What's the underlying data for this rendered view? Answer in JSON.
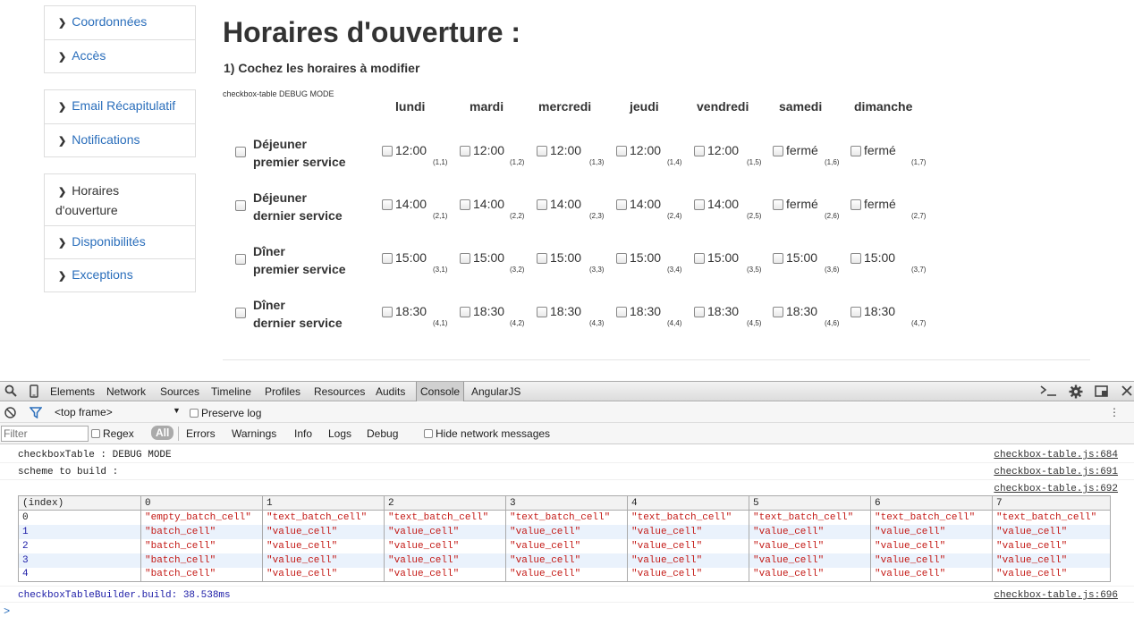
{
  "sidebar": {
    "group1": [
      "Coordonnées",
      "Accès"
    ],
    "group2": [
      "Email Récapitulatif",
      "Notifications"
    ],
    "group3_active": "Horaires d'ouverture",
    "group3": [
      "Disponibilités",
      "Exceptions"
    ]
  },
  "main": {
    "title": "Horaires d'ouverture :",
    "step": "1) Cochez les horaires à modifier",
    "debug": "checkbox-table DEBUG MODE",
    "days": [
      "lundi",
      "mardi",
      "mercredi",
      "jeudi",
      "vendredi",
      "samedi",
      "dimanche"
    ],
    "rows": [
      {
        "label1": "Déjeuner",
        "label2": "premier service",
        "values": [
          "12:00",
          "12:00",
          "12:00",
          "12:00",
          "12:00",
          "fermé",
          "fermé"
        ],
        "idx": [
          "(1,1)",
          "(1,2)",
          "(1,3)",
          "(1,4)",
          "(1,5)",
          "(1,6)",
          "(1,7)"
        ]
      },
      {
        "label1": "Déjeuner",
        "label2": "dernier service",
        "values": [
          "14:00",
          "14:00",
          "14:00",
          "14:00",
          "14:00",
          "fermé",
          "fermé"
        ],
        "idx": [
          "(2,1)",
          "(2,2)",
          "(2,3)",
          "(2,4)",
          "(2,5)",
          "(2,6)",
          "(2,7)"
        ]
      },
      {
        "label1": "Dîner",
        "label2": "premier service",
        "values": [
          "15:00",
          "15:00",
          "15:00",
          "15:00",
          "15:00",
          "15:00",
          "15:00"
        ],
        "idx": [
          "(3,1)",
          "(3,2)",
          "(3,3)",
          "(3,4)",
          "(3,5)",
          "(3,6)",
          "(3,7)"
        ]
      },
      {
        "label1": "Dîner",
        "label2": "dernier service",
        "values": [
          "18:30",
          "18:30",
          "18:30",
          "18:30",
          "18:30",
          "18:30",
          "18:30"
        ],
        "idx": [
          "(4,1)",
          "(4,2)",
          "(4,3)",
          "(4,4)",
          "(4,5)",
          "(4,6)",
          "(4,7)"
        ]
      }
    ]
  },
  "devtools": {
    "tabs": [
      "Elements",
      "Network",
      "Sources",
      "Timeline",
      "Profiles",
      "Resources",
      "Audits",
      "Console",
      "AngularJS"
    ],
    "selected_tab": "Console",
    "frame": "<top frame>",
    "preserve_log": "Preserve log",
    "filter_placeholder": "Filter",
    "regex": "Regex",
    "levels": [
      "All",
      "Errors",
      "Warnings",
      "Info",
      "Logs",
      "Debug"
    ],
    "hide_network": "Hide network messages",
    "console_lines": [
      {
        "text": "checkboxTable : DEBUG MODE",
        "src": "checkbox-table.js:684"
      },
      {
        "text": "scheme to build :",
        "src": "checkbox-table.js:691"
      },
      {
        "text": "",
        "src": "checkbox-table.js:692"
      }
    ],
    "table_headers": [
      "(index)",
      "0",
      "1",
      "2",
      "3",
      "4",
      "5",
      "6",
      "7"
    ],
    "table_rows": [
      [
        "0",
        "\"empty_batch_cell\"",
        "\"text_batch_cell\"",
        "\"text_batch_cell\"",
        "\"text_batch_cell\"",
        "\"text_batch_cell\"",
        "\"text_batch_cell\"",
        "\"text_batch_cell\"",
        "\"text_batch_cell\""
      ],
      [
        "1",
        "\"batch_cell\"",
        "\"value_cell\"",
        "\"value_cell\"",
        "\"value_cell\"",
        "\"value_cell\"",
        "\"value_cell\"",
        "\"value_cell\"",
        "\"value_cell\""
      ],
      [
        "2",
        "\"batch_cell\"",
        "\"value_cell\"",
        "\"value_cell\"",
        "\"value_cell\"",
        "\"value_cell\"",
        "\"value_cell\"",
        "\"value_cell\"",
        "\"value_cell\""
      ],
      [
        "3",
        "\"batch_cell\"",
        "\"value_cell\"",
        "\"value_cell\"",
        "\"value_cell\"",
        "\"value_cell\"",
        "\"value_cell\"",
        "\"value_cell\"",
        "\"value_cell\""
      ],
      [
        "4",
        "\"batch_cell\"",
        "\"value_cell\"",
        "\"value_cell\"",
        "\"value_cell\"",
        "\"value_cell\"",
        "\"value_cell\"",
        "\"value_cell\"",
        "\"value_cell\""
      ]
    ],
    "timing_text": "checkboxTableBuilder.build: 38.538ms",
    "timing_src": "checkbox-table.js:696",
    "prompt": ">"
  }
}
